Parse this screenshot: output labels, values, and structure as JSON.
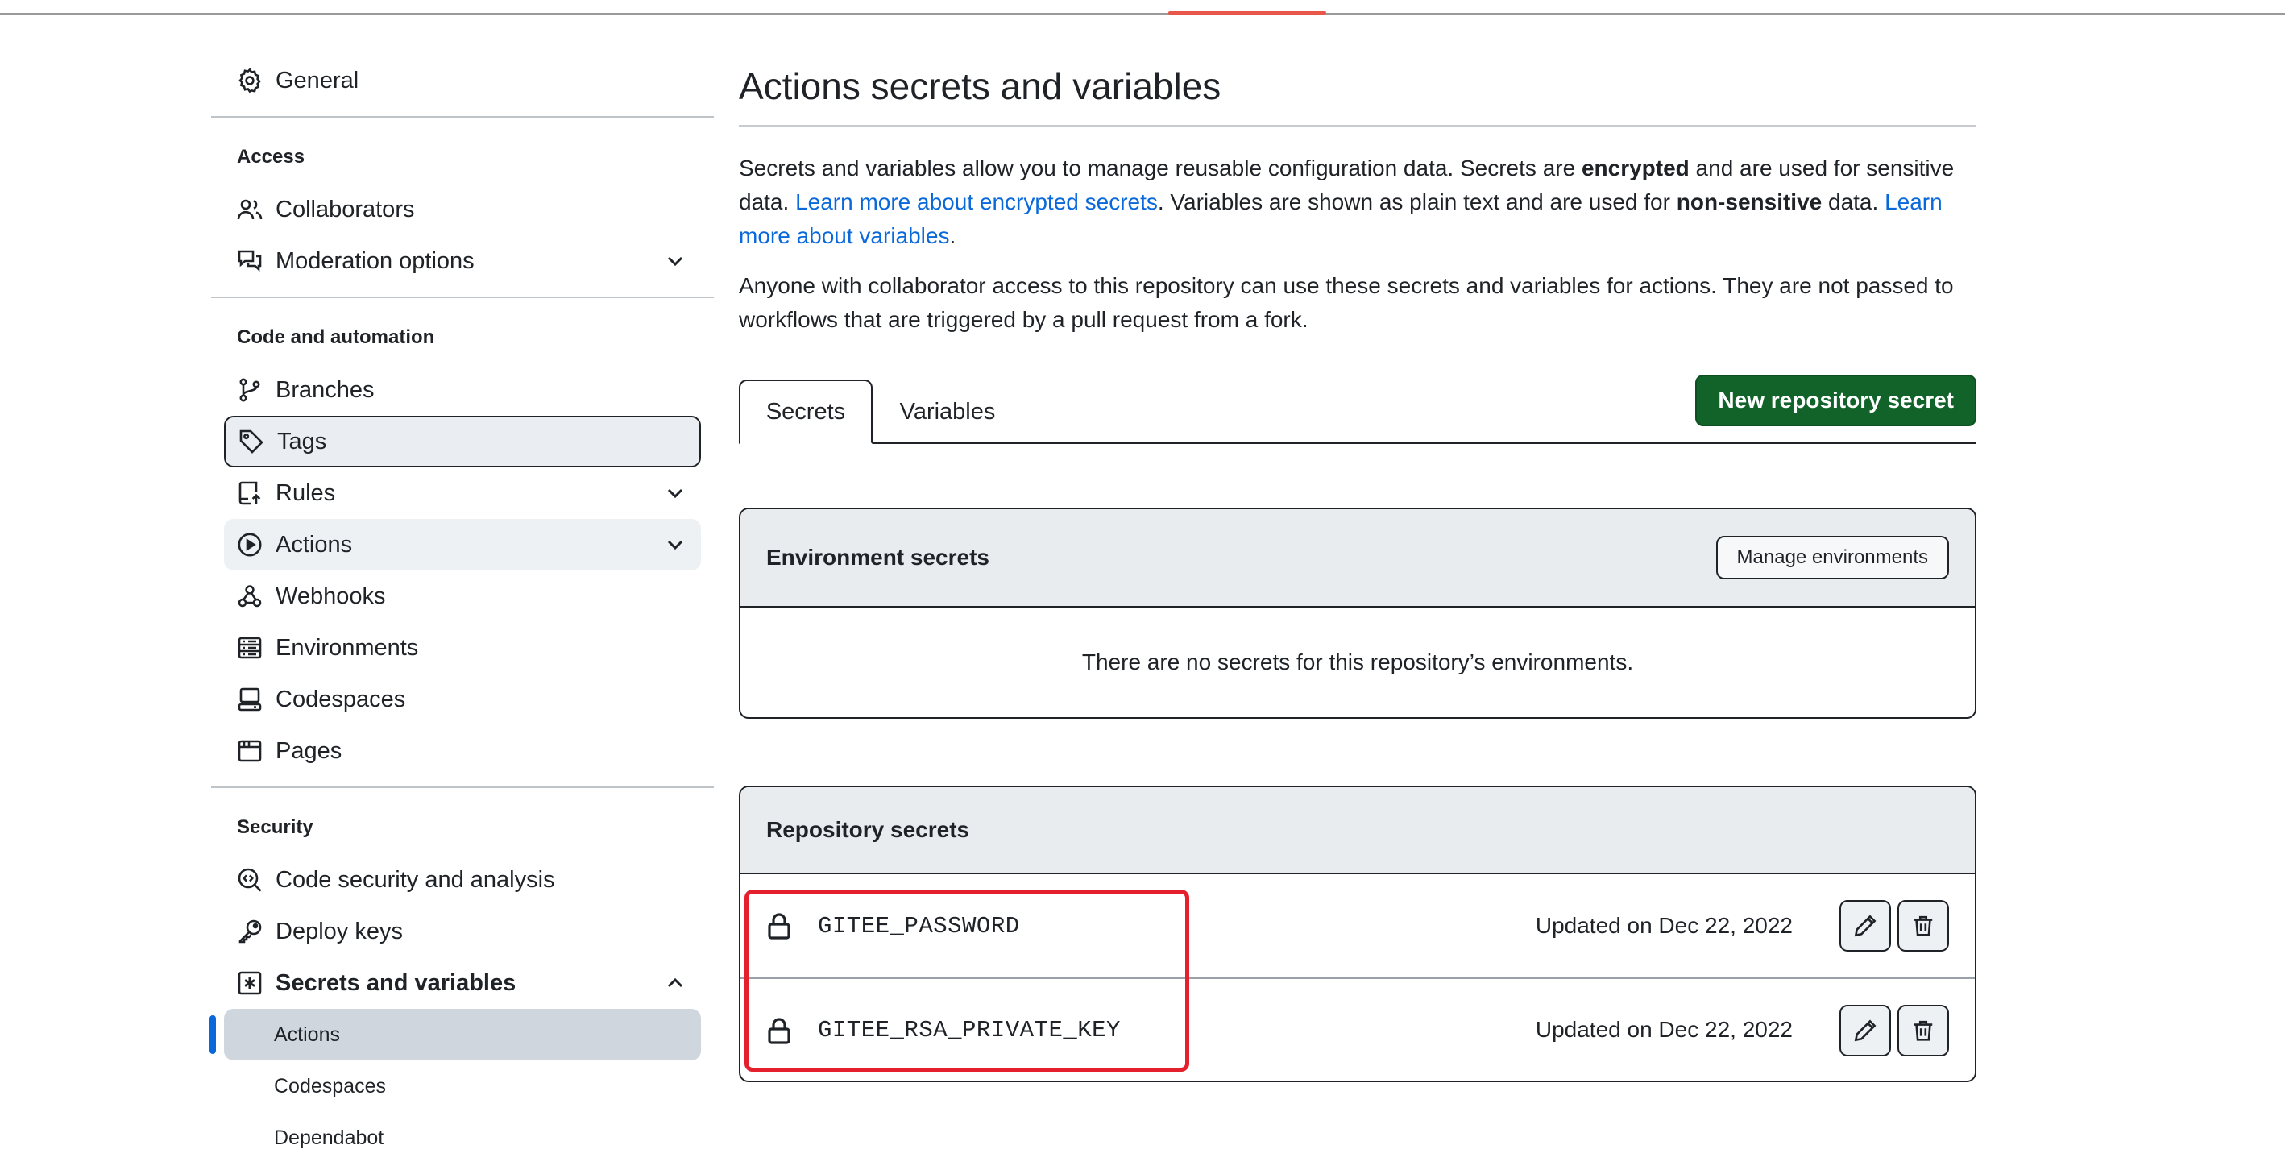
{
  "sidebar": {
    "general": "General",
    "sections": {
      "access": "Access",
      "code_automation": "Code and automation",
      "security": "Security"
    },
    "items": {
      "collaborators": "Collaborators",
      "moderation": "Moderation options",
      "branches": "Branches",
      "tags": "Tags",
      "rules": "Rules",
      "actions": "Actions",
      "webhooks": "Webhooks",
      "environments": "Environments",
      "codespaces": "Codespaces",
      "pages": "Pages",
      "code_security": "Code security and analysis",
      "deploy_keys": "Deploy keys",
      "secrets_variables": "Secrets and variables"
    },
    "subitems": {
      "actions": "Actions",
      "codespaces": "Codespaces",
      "dependabot": "Dependabot"
    }
  },
  "main": {
    "title": "Actions secrets and variables",
    "intro": {
      "p1_a": "Secrets and variables allow you to manage reusable configuration data. Secrets are ",
      "p1_b": "encrypted",
      "p1_c": " and are used for sensitive data. ",
      "p1_link1": "Learn more about encrypted secrets",
      "p1_d": ". Variables are shown as plain text and are used for ",
      "p1_e": "non-sensitive",
      "p1_f": " data. ",
      "p1_link2": "Learn more about variables",
      "p1_g": ".",
      "p2": "Anyone with collaborator access to this repository can use these secrets and variables for actions. They are not passed to workflows that are triggered by a pull request from a fork."
    },
    "tabs": {
      "secrets": "Secrets",
      "variables": "Variables"
    },
    "new_secret_button": "New repository secret",
    "env_secrets": {
      "heading": "Environment secrets",
      "manage_button": "Manage environments",
      "empty": "There are no secrets for this repository’s environments."
    },
    "repo_secrets": {
      "heading": "Repository secrets",
      "rows": [
        {
          "name": "GITEE_PASSWORD",
          "updated": "Updated on Dec 22, 2022"
        },
        {
          "name": "GITEE_RSA_PRIVATE_KEY",
          "updated": "Updated on Dec 22, 2022"
        }
      ]
    }
  },
  "colors": {
    "primary_button": "#116329",
    "link": "#0969da",
    "active_marker": "#0969da",
    "annotation_highlight": "#e5202e"
  },
  "icons": [
    "gear-icon",
    "people-icon",
    "comment-discussion-icon",
    "git-branch-icon",
    "tag-icon",
    "repo-push-icon",
    "play-icon",
    "webhook-icon",
    "server-icon",
    "codespaces-icon",
    "browser-icon",
    "codescan-icon",
    "key-icon",
    "key-asterisk-icon",
    "chevron-down-icon",
    "chevron-up-icon",
    "lock-icon",
    "pencil-icon",
    "trash-icon"
  ]
}
